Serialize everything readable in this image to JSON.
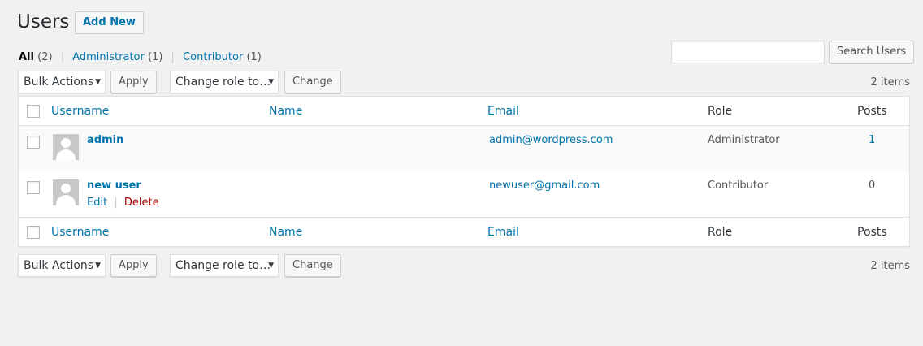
{
  "page": {
    "title": "Users",
    "add_new": "Add New"
  },
  "filters": {
    "all": {
      "label": "All",
      "count": "(2)"
    },
    "administrator": {
      "label": "Administrator",
      "count": "(1)"
    },
    "contributor": {
      "label": "Contributor",
      "count": "(1)"
    },
    "separator": "|"
  },
  "search": {
    "button": "Search Users",
    "value": ""
  },
  "toolbar": {
    "bulk_actions": "Bulk Actions",
    "apply": "Apply",
    "change_role": "Change role to…",
    "change": "Change",
    "items_count": "2 items"
  },
  "table": {
    "columns": {
      "username": "Username",
      "name": "Name",
      "email": "Email",
      "role": "Role",
      "posts": "Posts"
    },
    "rows": [
      {
        "username": "admin",
        "name": "",
        "email": "admin@wordpress.com",
        "role": "Administrator",
        "posts": "1"
      },
      {
        "username": "new user",
        "name": "",
        "email": "newuser@gmail.com",
        "role": "Contributor",
        "posts": "0",
        "actions": {
          "edit": "Edit",
          "separator": "|",
          "delete": "Delete"
        }
      }
    ]
  },
  "colors": {
    "link": "#0073aa",
    "delete": "#a00000",
    "background": "#f1f1f1"
  },
  "icons": {
    "caret": "dropdown-caret-icon",
    "avatar": "default-avatar-icon"
  }
}
